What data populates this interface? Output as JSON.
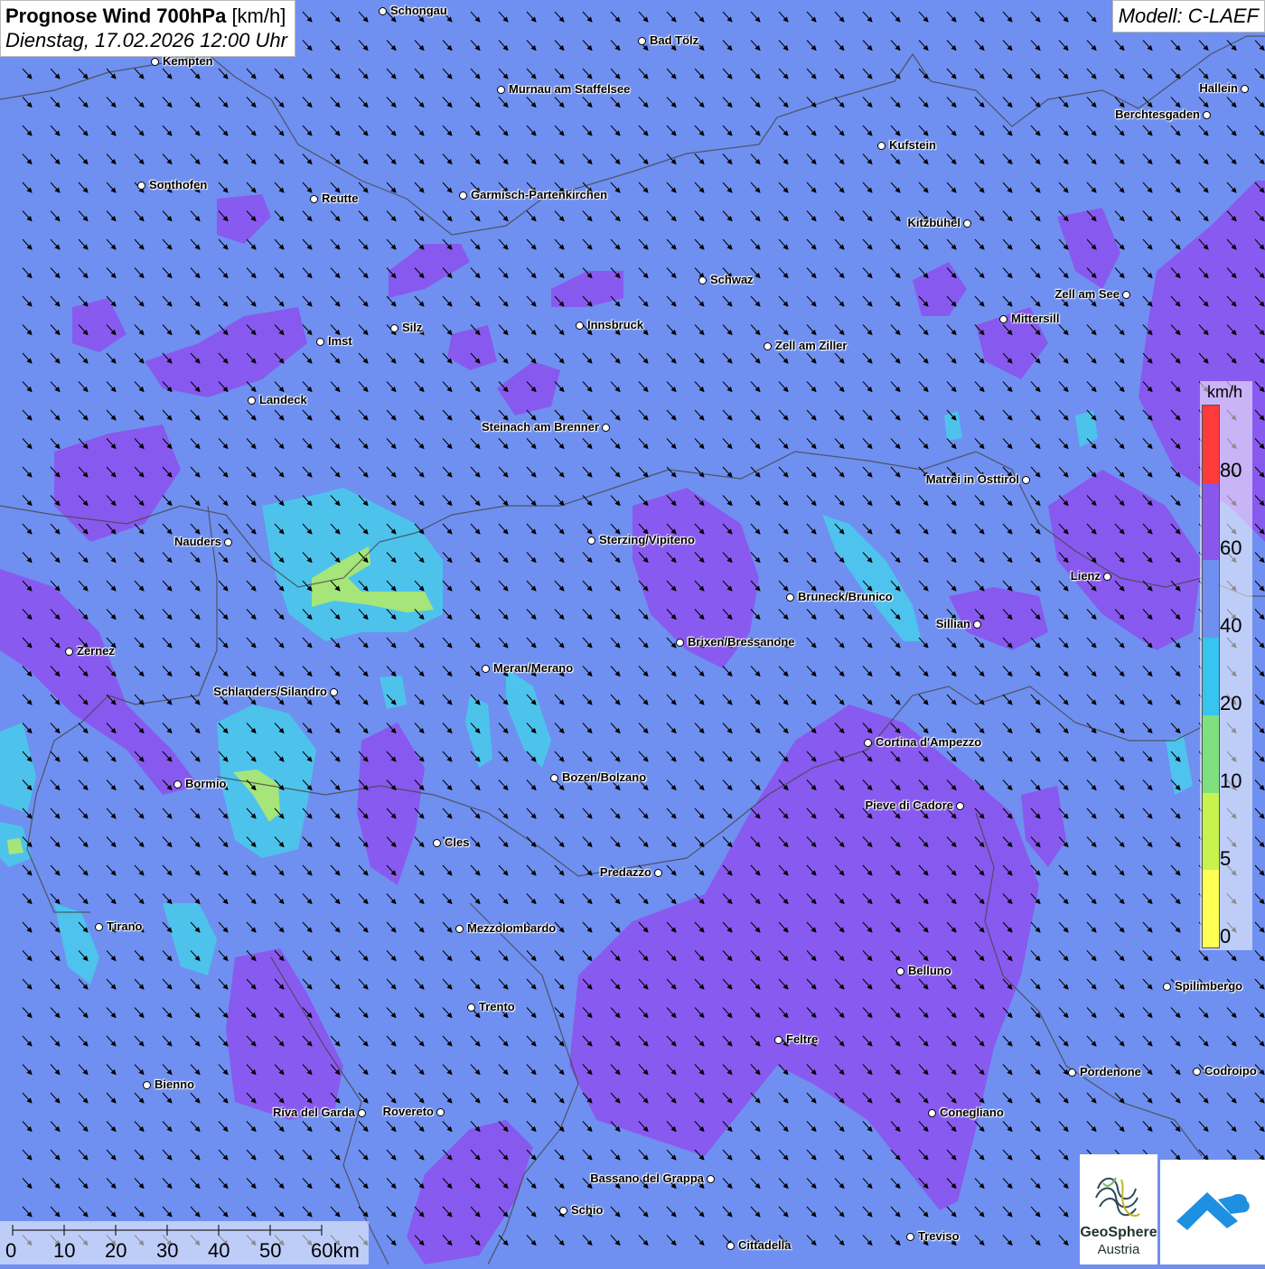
{
  "title": {
    "bold": "Prognose Wind 700hPa",
    "unit": "[km/h]",
    "datetime": "Dienstag, 17.02.2026 12:00 Uhr"
  },
  "model": "Modell: C-LAEF",
  "legend": {
    "unit": "km/h",
    "labels": [
      "80",
      "60",
      "40",
      "20",
      "10",
      "5",
      "0"
    ],
    "colors": [
      "#ff3a3a",
      "#8a57ee",
      "#6f90f0",
      "#37c4ef",
      "#7fe07f",
      "#c8f24e",
      "#ffff55"
    ]
  },
  "scalebar": {
    "labels": [
      "0",
      "10",
      "20",
      "30",
      "40",
      "50",
      "60km"
    ]
  },
  "logo": {
    "name_line1": "GeoSphere",
    "name_line2": "Austria"
  },
  "colors": {
    "base": "#6f90f0",
    "purple": "#8a57ee",
    "cyan": "#4cc6ec",
    "green": "#a9ea73"
  },
  "cities": [
    {
      "name": "Schongau"
    },
    {
      "name": "Bad Tölz"
    },
    {
      "name": "Kempten"
    },
    {
      "name": "Murnau am Staffelsee"
    },
    {
      "name": "Hallein"
    },
    {
      "name": "Berchtesgaden"
    },
    {
      "name": "Kufstein"
    },
    {
      "name": "Sonthofen"
    },
    {
      "name": "Reutte"
    },
    {
      "name": "Garmisch-Partenkirchen"
    },
    {
      "name": "Kitzbühel"
    },
    {
      "name": "Schwaz"
    },
    {
      "name": "Zell am See"
    },
    {
      "name": "Mittersill"
    },
    {
      "name": "Silz"
    },
    {
      "name": "Innsbruck"
    },
    {
      "name": "Imst"
    },
    {
      "name": "Zell am Ziller"
    },
    {
      "name": "Landeck"
    },
    {
      "name": "Steinach am Brenner"
    },
    {
      "name": "Matrei in Osttirol"
    },
    {
      "name": "Nauders"
    },
    {
      "name": "Sterzing/Vipiteno"
    },
    {
      "name": "Lienz"
    },
    {
      "name": "Bruneck/Brunico"
    },
    {
      "name": "Sillian"
    },
    {
      "name": "Brixen/Bressanone"
    },
    {
      "name": "Zernez"
    },
    {
      "name": "Meran/Merano"
    },
    {
      "name": "Schlanders/Silandro"
    },
    {
      "name": "Cortina d'Ampezzo"
    },
    {
      "name": "Bozen/Bolzano"
    },
    {
      "name": "Bormio"
    },
    {
      "name": "Pieve di Cadore"
    },
    {
      "name": "Cles"
    },
    {
      "name": "Predazzo"
    },
    {
      "name": "Tirano"
    },
    {
      "name": "Mezzolombardo"
    },
    {
      "name": "Belluno"
    },
    {
      "name": "Spilimbergo"
    },
    {
      "name": "Trento"
    },
    {
      "name": "Feltre"
    },
    {
      "name": "Bienno"
    },
    {
      "name": "Pordenone"
    },
    {
      "name": "Codroipo"
    },
    {
      "name": "Riva del Garda"
    },
    {
      "name": "Rovereto"
    },
    {
      "name": "Conegliano"
    },
    {
      "name": "Bassano del Grappa"
    },
    {
      "name": "Schio"
    },
    {
      "name": "Treviso"
    },
    {
      "name": "Cittadella"
    }
  ]
}
